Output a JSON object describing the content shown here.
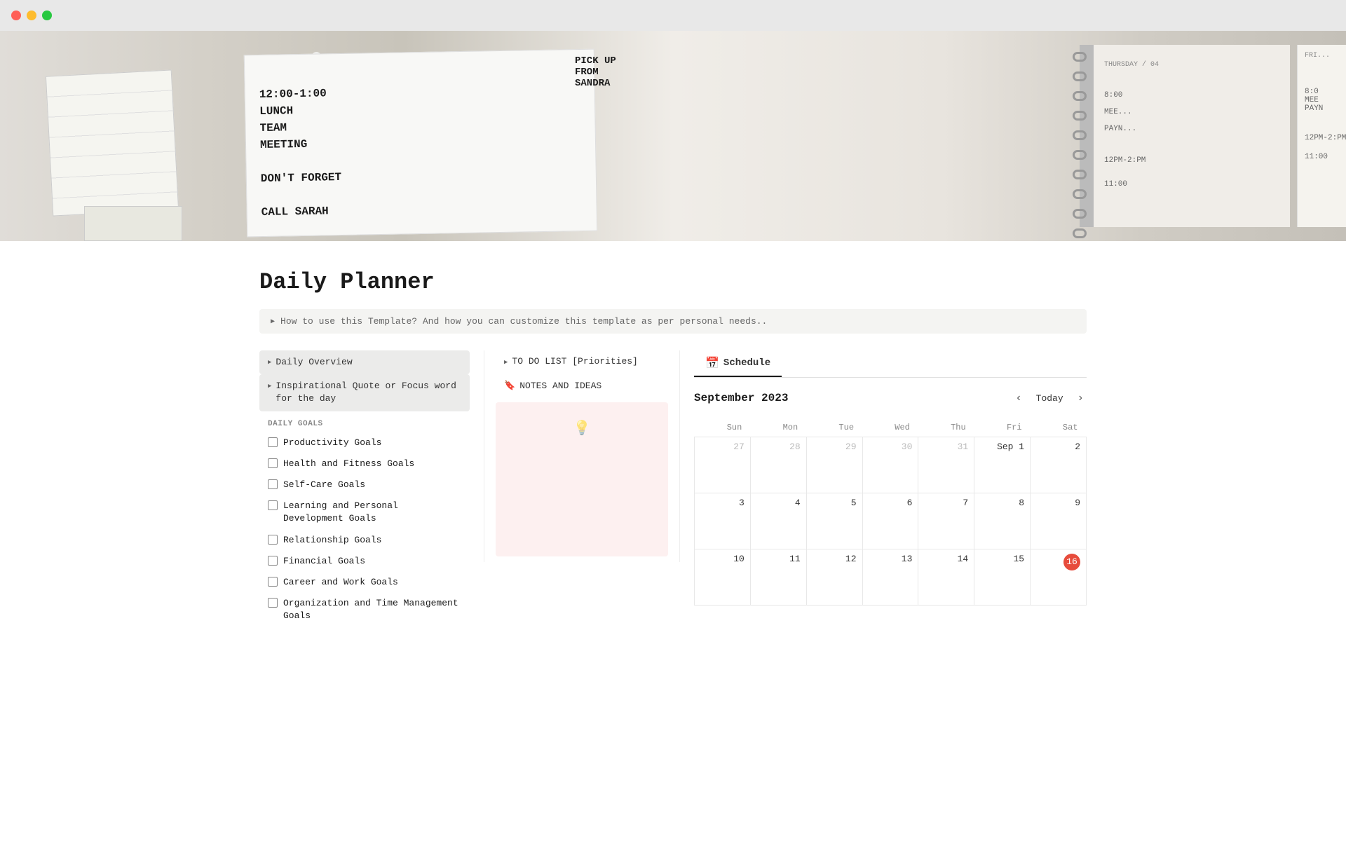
{
  "window": {
    "title": "Daily Planner"
  },
  "hero": {
    "notepad_text": "12:00-1:00\nLUNCH\nTEAM\nMEETING\n\nDON'T FORGET\n\nCALL SARAH"
  },
  "page": {
    "title": "Daily Planner",
    "hint_text": "▶  How to use this Template? And how you can customize this template as per personal needs.."
  },
  "left_col": {
    "items": [
      {
        "label": "Daily Overview"
      },
      {
        "label": "Inspirational Quote or Focus word for the day"
      }
    ],
    "section_label": "DAILY GOALS",
    "goals": [
      {
        "label": "Productivity Goals"
      },
      {
        "label": "Health and Fitness Goals"
      },
      {
        "label": "Self-Care Goals"
      },
      {
        "label": "Learning and Personal Development Goals"
      },
      {
        "label": "Relationship Goals"
      },
      {
        "label": "Financial Goals"
      },
      {
        "label": "Career and Work Goals"
      },
      {
        "label": "Organization and Time Management Goals"
      }
    ]
  },
  "mid_col": {
    "todo_label": "TO DO LIST [Priorities]",
    "notes_label": "NOTES AND IDEAS",
    "bulb_icon": "💡"
  },
  "calendar": {
    "tab_label": "Schedule",
    "tab_icon": "📅",
    "month": "September 2023",
    "today_btn": "Today",
    "days": [
      "Sun",
      "Mon",
      "Tue",
      "Wed",
      "Thu",
      "Fri",
      "Sat"
    ],
    "weeks": [
      [
        {
          "num": "27",
          "current": false
        },
        {
          "num": "28",
          "current": false
        },
        {
          "num": "29",
          "current": false
        },
        {
          "num": "30",
          "current": false
        },
        {
          "num": "31",
          "current": false
        },
        {
          "num": "Sep 1",
          "current": true
        },
        {
          "num": "2",
          "current": true
        }
      ],
      [
        {
          "num": "3",
          "current": true
        },
        {
          "num": "4",
          "current": true
        },
        {
          "num": "5",
          "current": true
        },
        {
          "num": "6",
          "current": true
        },
        {
          "num": "7",
          "current": true
        },
        {
          "num": "8",
          "current": true
        },
        {
          "num": "9",
          "current": true
        }
      ],
      [
        {
          "num": "10",
          "current": true
        },
        {
          "num": "11",
          "current": true
        },
        {
          "num": "12",
          "current": true
        },
        {
          "num": "13",
          "current": true
        },
        {
          "num": "14",
          "current": true
        },
        {
          "num": "15",
          "current": true
        },
        {
          "num": "16",
          "current": true,
          "today": true
        }
      ]
    ]
  }
}
